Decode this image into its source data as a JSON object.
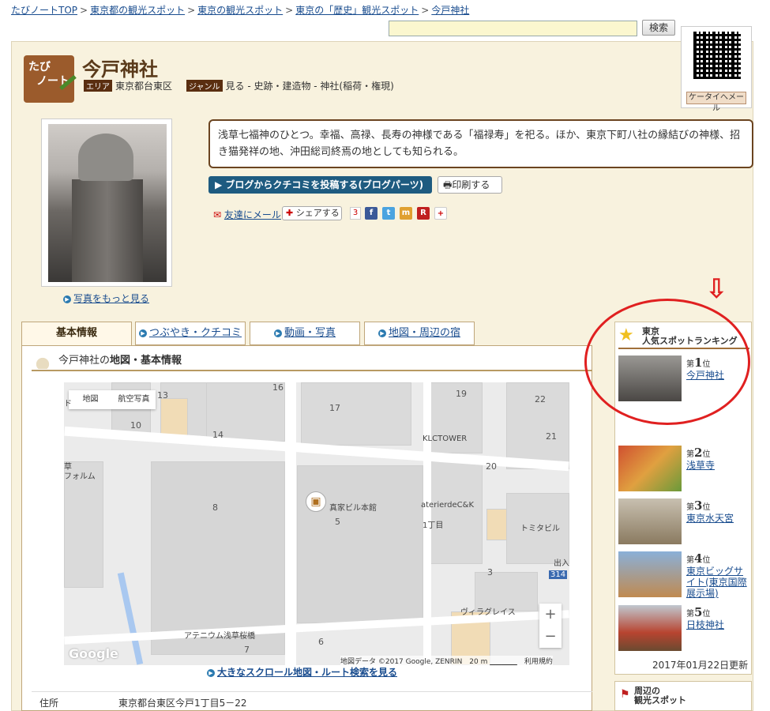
{
  "breadcrumb": [
    "たびノートTOP",
    "東京都の観光スポット",
    "東京の観光スポット",
    "東京の「歴史」観光スポット",
    "今戸神社"
  ],
  "search": {
    "placeholder": "",
    "button": "検索"
  },
  "mobile": {
    "button": "ケータイへメール"
  },
  "logo": {
    "line1": "たび",
    "line2": "ノート"
  },
  "spot": {
    "title": "今戸神社",
    "area_tag": "エリア",
    "area": "東京都台東区",
    "genre_tag": "ジャンル",
    "genre": "見る - 史跡・建造物 - 神社(稲荷・権現)",
    "description": "浅草七福神のひとつ。幸福、高禄、長寿の神様である「福禄寿」を祀る。ほか、東京下町八社の縁結びの神様、招き猫発祥の地、沖田総司終焉の地としても知られる。"
  },
  "photo": {
    "more": "写真をもっと見る"
  },
  "actions": {
    "blog": "ブログからクチコミを投稿する(ブログパーツ)",
    "print": "印刷する",
    "mail": "友達にメール",
    "share": "シェアする",
    "share_count": "3"
  },
  "tabs": [
    "基本情報",
    "つぶやき・クチコミ",
    "動画・写真",
    "地図・周辺の宿"
  ],
  "panel": {
    "heading_pre": "今戸神社の",
    "heading_bold": "地図・基本情報"
  },
  "map": {
    "type_map": "地図",
    "type_sat": "航空写真",
    "labels": {
      "n13": "13",
      "n16": "16",
      "n19": "19",
      "n22": "22",
      "n10": "10",
      "n17": "17",
      "n14": "14",
      "n21": "21",
      "n20": "20",
      "n8": "8",
      "n5": "5",
      "n3": "3",
      "n7": "7",
      "n6": "6",
      "klc": "KLCTOWER",
      "sanke": "真家ビル本館",
      "atelier": "aterierdeC&K",
      "chome": "1丁目",
      "tomita": "トミタビル",
      "villa": "ヴィラグレイス",
      "atenium": "アテニウム浅草桜橋",
      "forum": "フォルム",
      "kusa": "草",
      "do": "ド",
      "de": "出入",
      "r314": "314"
    },
    "zoom_in": "+",
    "zoom_out": "−",
    "credit": "地図データ ©2017 Google, ZENRIN　20 m ▁▁▁▁▁　利用規約",
    "google": "Google"
  },
  "big_map_link": "大きなスクロール地図・ルート検索を見る",
  "address": {
    "label": "住所",
    "value": "東京都台東区今戸1丁目5－22"
  },
  "ranking": {
    "head1": "東京",
    "head2": "人気スポットランキング",
    "items": [
      {
        "rank": "1",
        "pre": "第",
        "post": "位",
        "name": "今戸神社",
        "color": "#6f6d6a"
      },
      {
        "rank": "2",
        "pre": "第",
        "post": "位",
        "name": "浅草寺",
        "color": "#c0622a"
      },
      {
        "rank": "3",
        "pre": "第",
        "post": "位",
        "name": "東京水天宮",
        "color": "#a89a80"
      },
      {
        "rank": "4",
        "pre": "第",
        "post": "位",
        "name": "東京ビッグサイト(東京国際展示場)",
        "color": "#7c9cb8"
      },
      {
        "rank": "5",
        "pre": "第",
        "post": "位",
        "name": "日枝神社",
        "color": "#b84430"
      }
    ],
    "updated": "2017年01月22日更新"
  },
  "nearby": {
    "head1": "周辺の",
    "head2": "観光スポット"
  },
  "arrow": "⇩"
}
